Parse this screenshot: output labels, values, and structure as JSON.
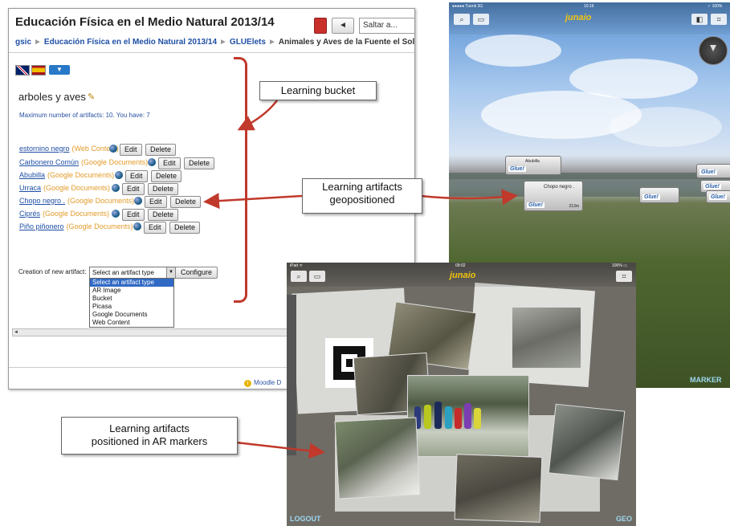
{
  "moodle": {
    "title": "Educación Física en el Medio Natural 2013/14",
    "jump_label": "Saltar a...",
    "back_label": "◄",
    "breadcrumbs": [
      "gsic",
      "Educación Física en el Medio Natural 2013/14",
      "GLUElets",
      "Animales y Aves de la Fuente el Sol"
    ],
    "bucket_title": "arboles y aves",
    "bucket_info": "Maximum number of artifacts: 10. You have: 7",
    "artifacts": [
      {
        "name": "estornino negro",
        "type": "(Web Content)"
      },
      {
        "name": "Carbonero Común",
        "type": "(Google Documents)"
      },
      {
        "name": "Abubilla",
        "type": "(Google Documents)"
      },
      {
        "name": "Urraca",
        "type": "(Google Documents)"
      },
      {
        "name": "Chopo negro .",
        "type": "(Google Documents)"
      },
      {
        "name": "Ciprés",
        "type": "(Google Documents)"
      },
      {
        "name": "Piño piñonero",
        "type": "(Google Documents)"
      }
    ],
    "edit_label": "Edit",
    "delete_label": "Delete",
    "creation_label": "Creation of new artifact:",
    "select_value": "Select an artifact type",
    "configure_label": "Configure",
    "select_options": [
      "Select an artifact type",
      "AR Image",
      "Bucket",
      "Picasa",
      "Google Documents",
      "Web Content"
    ],
    "footer_link": "Moodle D"
  },
  "ar_top": {
    "status": "●●●●● Tuenti 3G",
    "time": "10:16",
    "battery": "✓ 100%",
    "brand": "junaio",
    "poi_main": {
      "title": "Chopo negro .",
      "distance": "213m",
      "logo": "Glue!"
    },
    "poi_abubilla": {
      "title": "Abubilla",
      "logo": "Glue!"
    },
    "poi_logo": "Glue!",
    "mode_label": "MARKER"
  },
  "ar_bottom": {
    "status": "iPad ᯤ",
    "time": "09:02",
    "battery": "100% ▭",
    "brand": "junaio",
    "logout_label": "LOGOUT",
    "geo_label": "GEO"
  },
  "callouts": {
    "bucket": "Learning bucket",
    "geo_line1": "Learning artifacts",
    "geo_line2": "geopositioned",
    "markers_line1": "Learning artifacts",
    "markers_line2": "positioned in AR markers"
  },
  "colors": {
    "arrow": "#c0392b",
    "link": "#1f4fa5",
    "type": "#e39b2a",
    "ar_label": "#9fd8f0",
    "brand": "#f1c40f"
  },
  "icons": [
    "uk-flag-icon",
    "spain-flag-icon",
    "pencil-icon",
    "globe-icon",
    "search-icon",
    "info-icon",
    "radar-icon"
  ]
}
